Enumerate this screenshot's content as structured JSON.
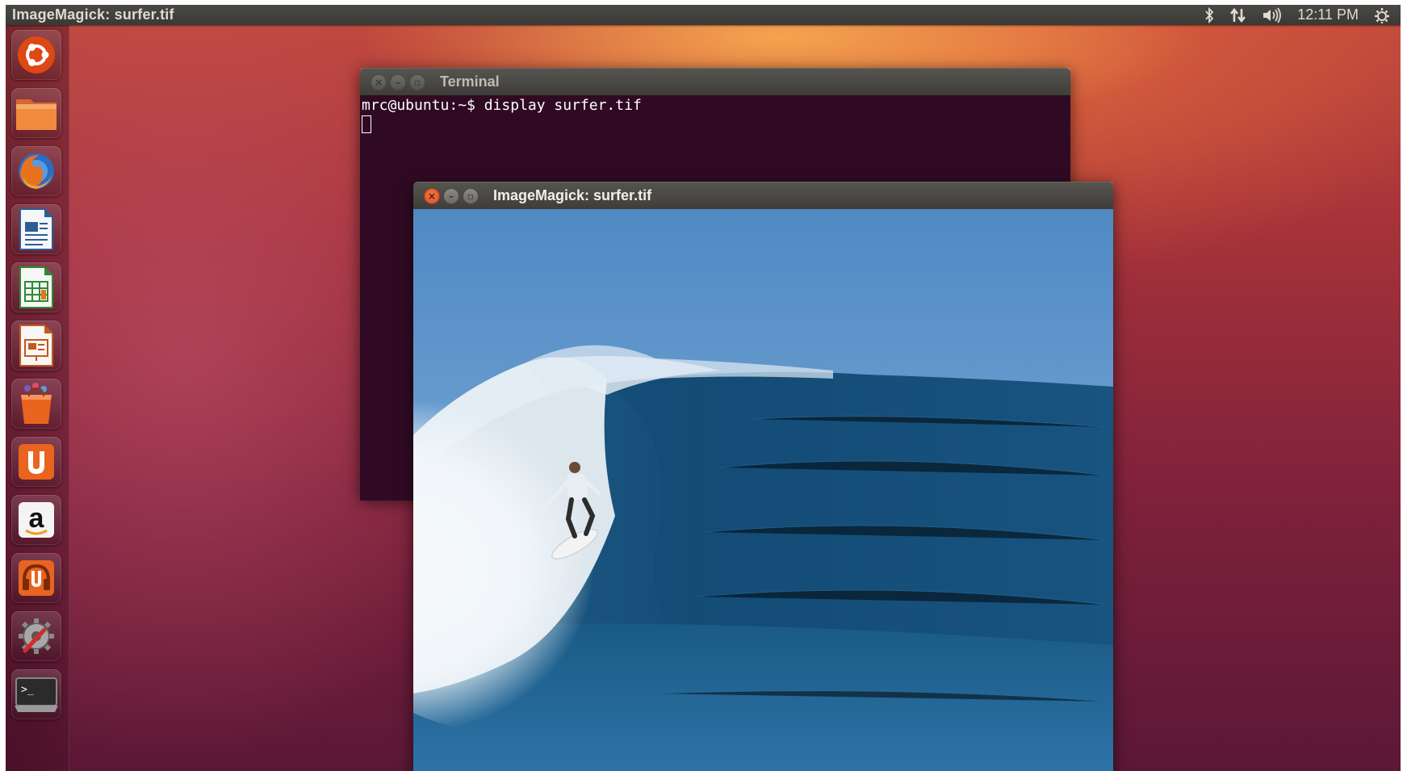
{
  "top_panel": {
    "active_app_title": "ImageMagick: surfer.tif",
    "clock": "12:11 PM",
    "indicators": [
      "bluetooth-icon",
      "network-icon",
      "volume-icon",
      "session-gear-icon"
    ]
  },
  "launcher": {
    "items": [
      {
        "name": "ubuntu-dash",
        "icon": "ubuntu-logo-icon"
      },
      {
        "name": "files",
        "icon": "folder-icon"
      },
      {
        "name": "firefox",
        "icon": "firefox-icon"
      },
      {
        "name": "libreoffice-writer",
        "icon": "writer-icon"
      },
      {
        "name": "libreoffice-calc",
        "icon": "calc-icon"
      },
      {
        "name": "libreoffice-impress",
        "icon": "impress-icon"
      },
      {
        "name": "software-center",
        "icon": "shopping-bag-icon"
      },
      {
        "name": "ubuntu-one",
        "icon": "ubuntu-one-icon"
      },
      {
        "name": "amazon",
        "icon": "amazon-icon",
        "label": "a"
      },
      {
        "name": "ubuntu-one-music",
        "icon": "ubuntu-one-music-icon"
      },
      {
        "name": "system-settings",
        "icon": "settings-wrench-icon"
      },
      {
        "name": "terminal",
        "icon": "terminal-icon",
        "label": ">_"
      }
    ]
  },
  "terminal_window": {
    "title": "Terminal",
    "prompt_line": "mrc@ubuntu:~$ display surfer.tif"
  },
  "image_window": {
    "title": "ImageMagick: surfer.tif",
    "image_description_icon": "surfer-photo"
  },
  "colors": {
    "terminal_bg": "#300a24",
    "close_button": "#e0582a",
    "panel_bg": "#3c3b37"
  }
}
